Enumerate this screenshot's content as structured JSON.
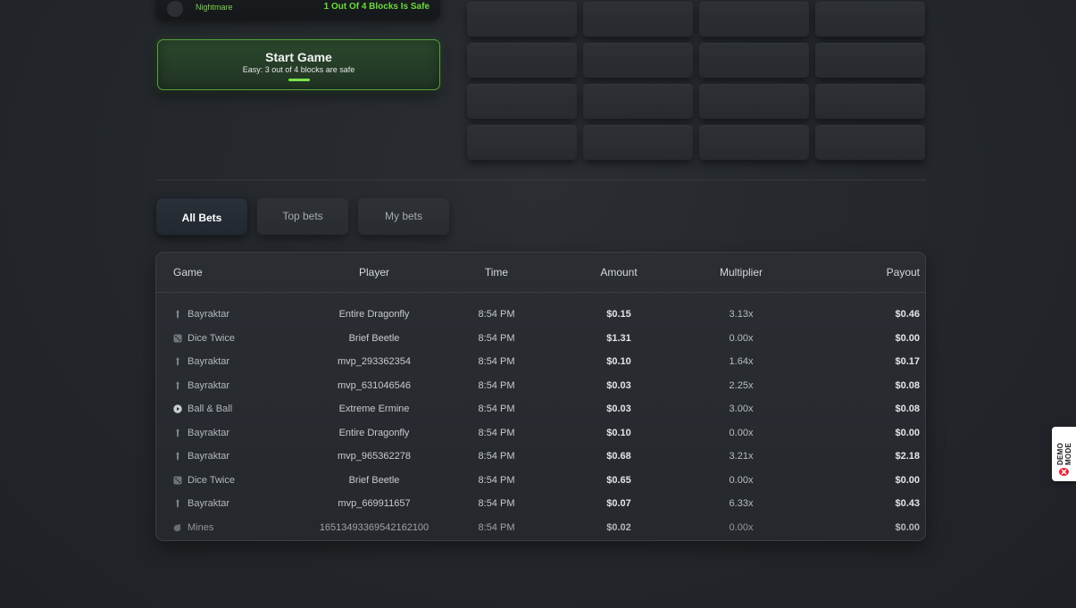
{
  "difficulty": {
    "level": "Nightmare",
    "description": "1 Out Of 4 Blocks Is Safe"
  },
  "start_game": {
    "title": "Start Game",
    "subtitle": "Easy: 3 out of 4 blocks are safe"
  },
  "tabs": [
    {
      "label": "All Bets",
      "active": true
    },
    {
      "label": "Top bets",
      "active": false
    },
    {
      "label": "My bets",
      "active": false
    }
  ],
  "bets_table": {
    "headers": {
      "game": "Game",
      "player": "Player",
      "time": "Time",
      "amount": "Amount",
      "multiplier": "Multiplier",
      "payout": "Payout"
    },
    "rows": [
      {
        "game": "Bayraktar",
        "icon": "rocket-icon",
        "player": "Entire Dragonfly",
        "time": "8:54 PM",
        "amount": "$0.15",
        "multiplier": "3.13x",
        "payout": "$0.46"
      },
      {
        "game": "Dice Twice",
        "icon": "dice-icon",
        "player": "Brief Beetle",
        "time": "8:54 PM",
        "amount": "$1.31",
        "multiplier": "0.00x",
        "payout": "$0.00"
      },
      {
        "game": "Bayraktar",
        "icon": "rocket-icon",
        "player": "mvp_293362354",
        "time": "8:54 PM",
        "amount": "$0.10",
        "multiplier": "1.64x",
        "payout": "$0.17"
      },
      {
        "game": "Bayraktar",
        "icon": "rocket-icon",
        "player": "mvp_631046546",
        "time": "8:54 PM",
        "amount": "$0.03",
        "multiplier": "2.25x",
        "payout": "$0.08"
      },
      {
        "game": "Ball & Ball",
        "icon": "ball-icon",
        "player": "Extreme Ermine",
        "time": "8:54 PM",
        "amount": "$0.03",
        "multiplier": "3.00x",
        "payout": "$0.08"
      },
      {
        "game": "Bayraktar",
        "icon": "rocket-icon",
        "player": "Entire Dragonfly",
        "time": "8:54 PM",
        "amount": "$0.10",
        "multiplier": "0.00x",
        "payout": "$0.00"
      },
      {
        "game": "Bayraktar",
        "icon": "rocket-icon",
        "player": "mvp_965362278",
        "time": "8:54 PM",
        "amount": "$0.68",
        "multiplier": "3.21x",
        "payout": "$2.18"
      },
      {
        "game": "Dice Twice",
        "icon": "dice-icon",
        "player": "Brief Beetle",
        "time": "8:54 PM",
        "amount": "$0.65",
        "multiplier": "0.00x",
        "payout": "$0.00"
      },
      {
        "game": "Bayraktar",
        "icon": "rocket-icon",
        "player": "mvp_669911657",
        "time": "8:54 PM",
        "amount": "$0.07",
        "multiplier": "6.33x",
        "payout": "$0.43"
      },
      {
        "game": "Mines",
        "icon": "mine-icon",
        "player": "1651349336954216210​0",
        "time": "8:54 PM",
        "amount": "$0.02",
        "multiplier": "0.00x",
        "payout": "$0.00"
      }
    ]
  },
  "demo_badge": {
    "label": "DEMO MODE"
  },
  "colors": {
    "accent_green": "#7be34a",
    "background": "#23272b",
    "badge_red": "#e0263a"
  }
}
